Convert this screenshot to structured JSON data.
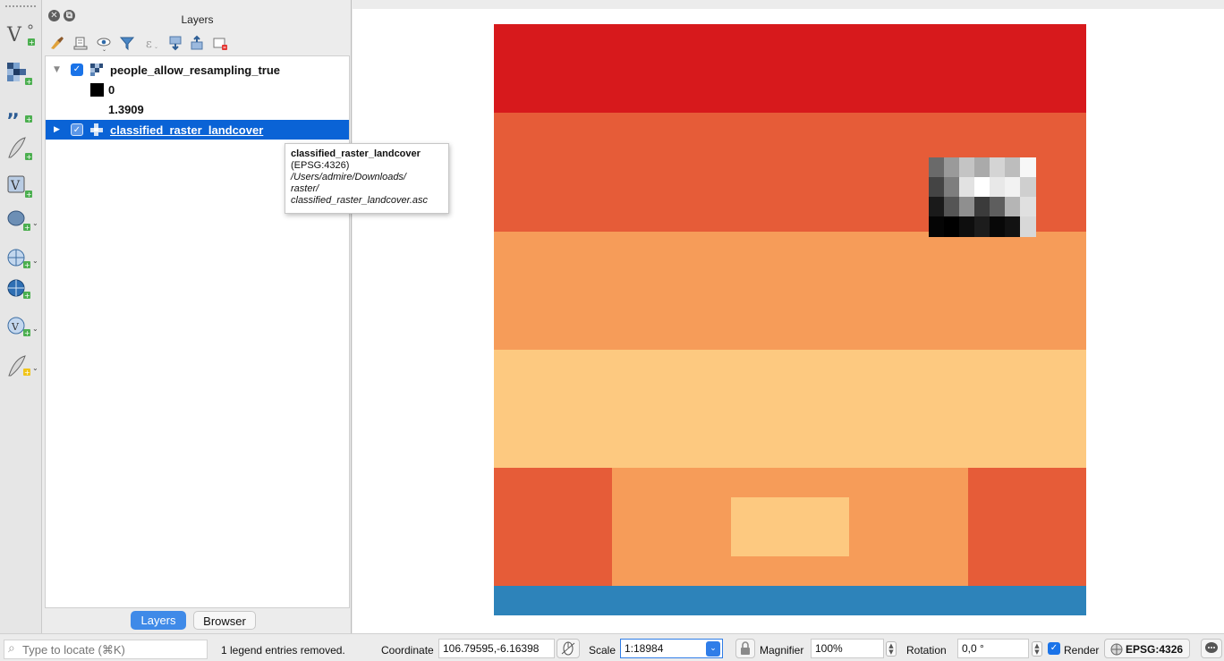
{
  "layers_panel": {
    "title": "Layers",
    "toolbar_icons": [
      "open-layer-styling-icon",
      "add-group-icon",
      "manage-visibility-icon",
      "filter-legend-icon",
      "filter-by-expression-icon",
      "expand-all-icon",
      "collapse-all-icon",
      "remove-layer-icon"
    ],
    "layers": [
      {
        "name": "people_allow_resampling_true",
        "checked": true,
        "expanded": true,
        "legend_min": "0",
        "legend_max": "1.3909"
      },
      {
        "name": "classified_raster_landcover",
        "checked": true,
        "expanded": false,
        "selected": true
      }
    ],
    "tooltip": {
      "title": "classified_raster_landcover",
      "crs": "(EPSG:4326)",
      "path_lines": [
        "/Users/admire/Downloads/",
        "raster/",
        "classified_raster_landcover.asc"
      ]
    },
    "tabs": [
      {
        "label": "Layers",
        "active": true
      },
      {
        "label": "Browser",
        "active": false
      }
    ]
  },
  "left_toolbar": {
    "icons": [
      "new-vector-layer-icon",
      "new-raster-layer-icon",
      "new-delimited-text-layer-icon",
      "new-spatialite-layer-icon",
      "new-virtual-layer-icon",
      "add-postgis-layer-icon",
      "add-wms-layer-icon",
      "add-wcs-layer-icon",
      "add-wfs-layer-icon",
      "new-temporary-scratch-layer-icon"
    ]
  },
  "map": {
    "colors": {
      "red": "#d7191c",
      "orange_red": "#e65c38",
      "orange": "#f69c59",
      "light_orange": "#fdc980",
      "blue": "#2d83ba"
    }
  },
  "statusbar": {
    "locator_placeholder": "Type to locate (⌘K)",
    "message": "1 legend entries removed.",
    "coordinate_label": "Coordinate",
    "coordinate_value": "106.79595,-6.16398",
    "scale_label": "Scale",
    "scale_value": "1:18984",
    "magnifier_label": "Magnifier",
    "magnifier_value": "100%",
    "rotation_label": "Rotation",
    "rotation_value": "0,0 °",
    "render_label": "Render",
    "render_checked": true,
    "crs_label": "EPSG:4326"
  }
}
